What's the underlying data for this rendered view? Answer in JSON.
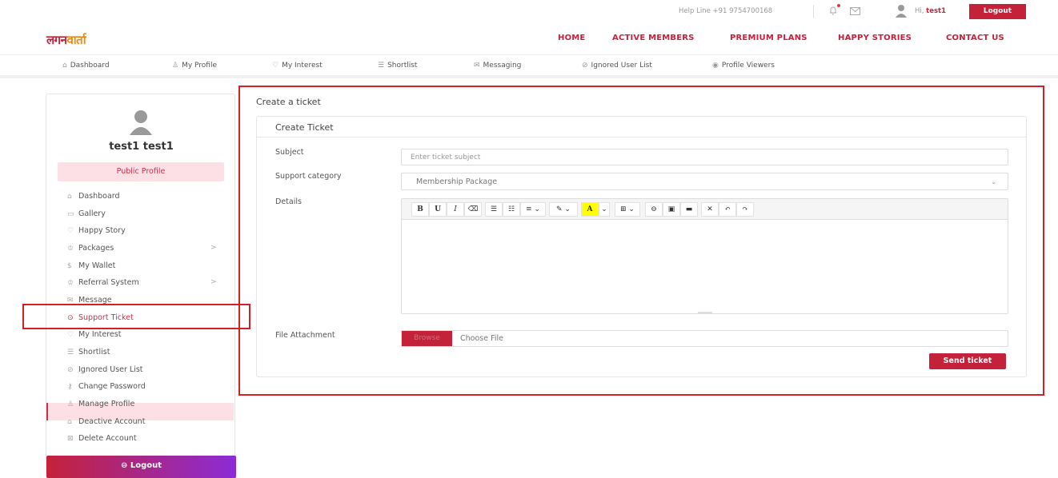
{
  "topbar": {
    "helpline": "Help Line +91 9754700168",
    "hi_prefix": "Hi,",
    "username": "test1",
    "logout": "Logout"
  },
  "brand": {
    "logo_part1": "लगन",
    "logo_part2": "वार्ता"
  },
  "mainnav": [
    "HOME",
    "ACTIVE MEMBERS",
    "PREMIUM PLANS",
    "HAPPY STORIES",
    "CONTACT US"
  ],
  "subnav": [
    {
      "icon": "⌂",
      "label": "Dashboard"
    },
    {
      "icon": "♙",
      "label": "My Profile"
    },
    {
      "icon": "♡",
      "label": "My Interest"
    },
    {
      "icon": "☰",
      "label": "Shortlist"
    },
    {
      "icon": "✉",
      "label": "Messaging"
    },
    {
      "icon": "⊘",
      "label": "Ignored User List"
    },
    {
      "icon": "◉",
      "label": "Profile Viewers"
    }
  ],
  "sidebar": {
    "name": "test1 test1",
    "public_profile": "Public Profile",
    "items": [
      {
        "icon": "⌂",
        "label": "Dashboard"
      },
      {
        "icon": "▭",
        "label": "Gallery"
      },
      {
        "icon": "♡",
        "label": "Happy Story"
      },
      {
        "icon": "♔",
        "label": "Packages"
      },
      {
        "icon": "$",
        "label": "My Wallet"
      },
      {
        "icon": "♔",
        "label": "Referral System"
      },
      {
        "icon": "✉",
        "label": "Message"
      },
      {
        "icon": "⊙",
        "label": "Support Ticket"
      },
      {
        "icon": "♡",
        "label": "My Interest"
      },
      {
        "icon": "☰",
        "label": "Shortlist"
      },
      {
        "icon": "⊘",
        "label": "Ignored User List"
      },
      {
        "icon": "⚷",
        "label": "Change Password"
      },
      {
        "icon": "♙",
        "label": "Manage Profile"
      },
      {
        "icon": "⌂",
        "label": "Deactive Account"
      },
      {
        "icon": "⊠",
        "label": "Delete Account"
      }
    ],
    "chevron": ">",
    "logout": "⊖ Logout"
  },
  "main": {
    "page_title": "Create a ticket",
    "card_title": "Create Ticket",
    "subject_label": "Subject",
    "subject_placeholder": "Enter ticket subject",
    "category_label": "Support category",
    "category_value": "Membership Package",
    "details_label": "Details",
    "file_label": "File Attachment",
    "browse": "Browse",
    "choose_file": "Choose File",
    "send": "Send ticket"
  },
  "toolbar_buttons": [
    "B",
    "U",
    "I",
    "⌫",
    "☰",
    "☷",
    "≡ ⌄",
    "✎ ⌄",
    "A",
    "⌄",
    "⊞ ⌄",
    "⊖",
    "▣",
    "▬",
    "✕",
    "↶",
    "↷"
  ],
  "colors": {
    "brand_red": "#c4223a",
    "highlight_red": "#d41f26",
    "active_bg": "#fde0e6"
  }
}
